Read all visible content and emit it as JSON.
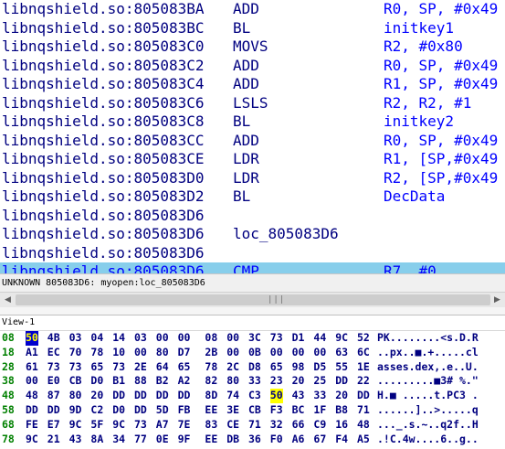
{
  "disassembly": {
    "lines": [
      {
        "addr": "libnqshield.so:805083BA",
        "mnem": "ADD",
        "ops": "R0, SP, #0x49"
      },
      {
        "addr": "libnqshield.so:805083BC",
        "mnem": "BL",
        "ops": " initkey1"
      },
      {
        "addr": "libnqshield.so:805083C0",
        "mnem": "MOVS",
        "ops": "R2, #0x80"
      },
      {
        "addr": "libnqshield.so:805083C2",
        "mnem": "ADD",
        "ops": "R0, SP, #0x49"
      },
      {
        "addr": "libnqshield.so:805083C4",
        "mnem": "ADD",
        "ops": "R1, SP, #0x49"
      },
      {
        "addr": "libnqshield.so:805083C6",
        "mnem": "LSLS",
        "ops": "R2, R2, #1"
      },
      {
        "addr": "libnqshield.so:805083C8",
        "mnem": "BL",
        "ops": " initkey2"
      },
      {
        "addr": "libnqshield.so:805083CC",
        "mnem": "ADD",
        "ops": "R0, SP, #0x49"
      },
      {
        "addr": "libnqshield.so:805083CE",
        "mnem": "LDR",
        "ops": "R1, [SP,#0x49"
      },
      {
        "addr": "libnqshield.so:805083D0",
        "mnem": "LDR",
        "ops": "R2, [SP,#0x49"
      },
      {
        "addr": "libnqshield.so:805083D2",
        "mnem": "BL",
        "ops": "DecData"
      },
      {
        "addr": "libnqshield.so:805083D6",
        "mnem": "",
        "ops": ""
      },
      {
        "addr": "libnqshield.so:805083D6",
        "mnem": "loc_805083D6",
        "ops": ""
      },
      {
        "addr": "libnqshield.so:805083D6",
        "mnem": "",
        "ops": ""
      },
      {
        "addr": "libnqshield.so:805083D6",
        "mnem": "CMP",
        "ops": "R7, #0"
      }
    ],
    "selected_index": 14
  },
  "status_line": "UNKNOWN 805083D6: myopen:loc_805083D6",
  "scrollbar": {
    "left_arrow": "◀",
    "right_arrow": "▶",
    "grip": "|||"
  },
  "hex_view": {
    "title": "View-1",
    "rows": [
      {
        "off": "08",
        "bytes": [
          "50",
          "4B",
          "03",
          "04",
          "14",
          "03",
          "00",
          "00",
          "08",
          "00",
          "3C",
          "73",
          "D1",
          "44",
          "9C",
          "52"
        ],
        "ascii": "PK........<s.D.R"
      },
      {
        "off": "18",
        "bytes": [
          "A1",
          "EC",
          "70",
          "78",
          "10",
          "00",
          "80",
          "D7",
          "2B",
          "00",
          "0B",
          "00",
          "00",
          "00",
          "63",
          "6C"
        ],
        "ascii": "..px..■.+.....cl"
      },
      {
        "off": "28",
        "bytes": [
          "61",
          "73",
          "73",
          "65",
          "73",
          "2E",
          "64",
          "65",
          "78",
          "2C",
          "D8",
          "65",
          "98",
          "D5",
          "55",
          "1E"
        ],
        "ascii": "asses.dex,.e..U."
      },
      {
        "off": "38",
        "bytes": [
          "00",
          "E0",
          "CB",
          "D0",
          "B1",
          "88",
          "B2",
          "A2",
          "82",
          "80",
          "33",
          "23",
          "20",
          "25",
          "DD",
          "22"
        ],
        "ascii": ".........■3# %.\""
      },
      {
        "off": "48",
        "bytes": [
          "48",
          "87",
          "80",
          "20",
          "DD",
          "DD",
          "DD",
          "DD",
          "8D",
          "74",
          "C3",
          "50",
          "43",
          "33",
          "20",
          "DD"
        ],
        "ascii": "H.■ .....t.PC3 ."
      },
      {
        "off": "58",
        "bytes": [
          "DD",
          "DD",
          "9D",
          "C2",
          "D0",
          "DD",
          "5D",
          "FB",
          "EE",
          "3E",
          "CB",
          "F3",
          "BC",
          "1F",
          "B8",
          "71"
        ],
        "ascii": "......]..>.....q"
      },
      {
        "off": "68",
        "bytes": [
          "FE",
          "E7",
          "9C",
          "5F",
          "9C",
          "73",
          "A7",
          "7E",
          "83",
          "CE",
          "71",
          "32",
          "66",
          "C9",
          "16",
          "48"
        ],
        "ascii": "..._.s.~..q2f..H"
      },
      {
        "off": "78",
        "bytes": [
          "9C",
          "21",
          "43",
          "8A",
          "34",
          "77",
          "0E",
          "9F",
          "EE",
          "DB",
          "36",
          "F0",
          "A6",
          "67",
          "F4",
          "A5"
        ],
        "ascii": ".!C.4w....6..g.."
      }
    ],
    "highlights": [
      {
        "row": 0,
        "col": 0,
        "style": "sel-blue"
      },
      {
        "row": 4,
        "col": 11,
        "style": "hl"
      }
    ]
  }
}
